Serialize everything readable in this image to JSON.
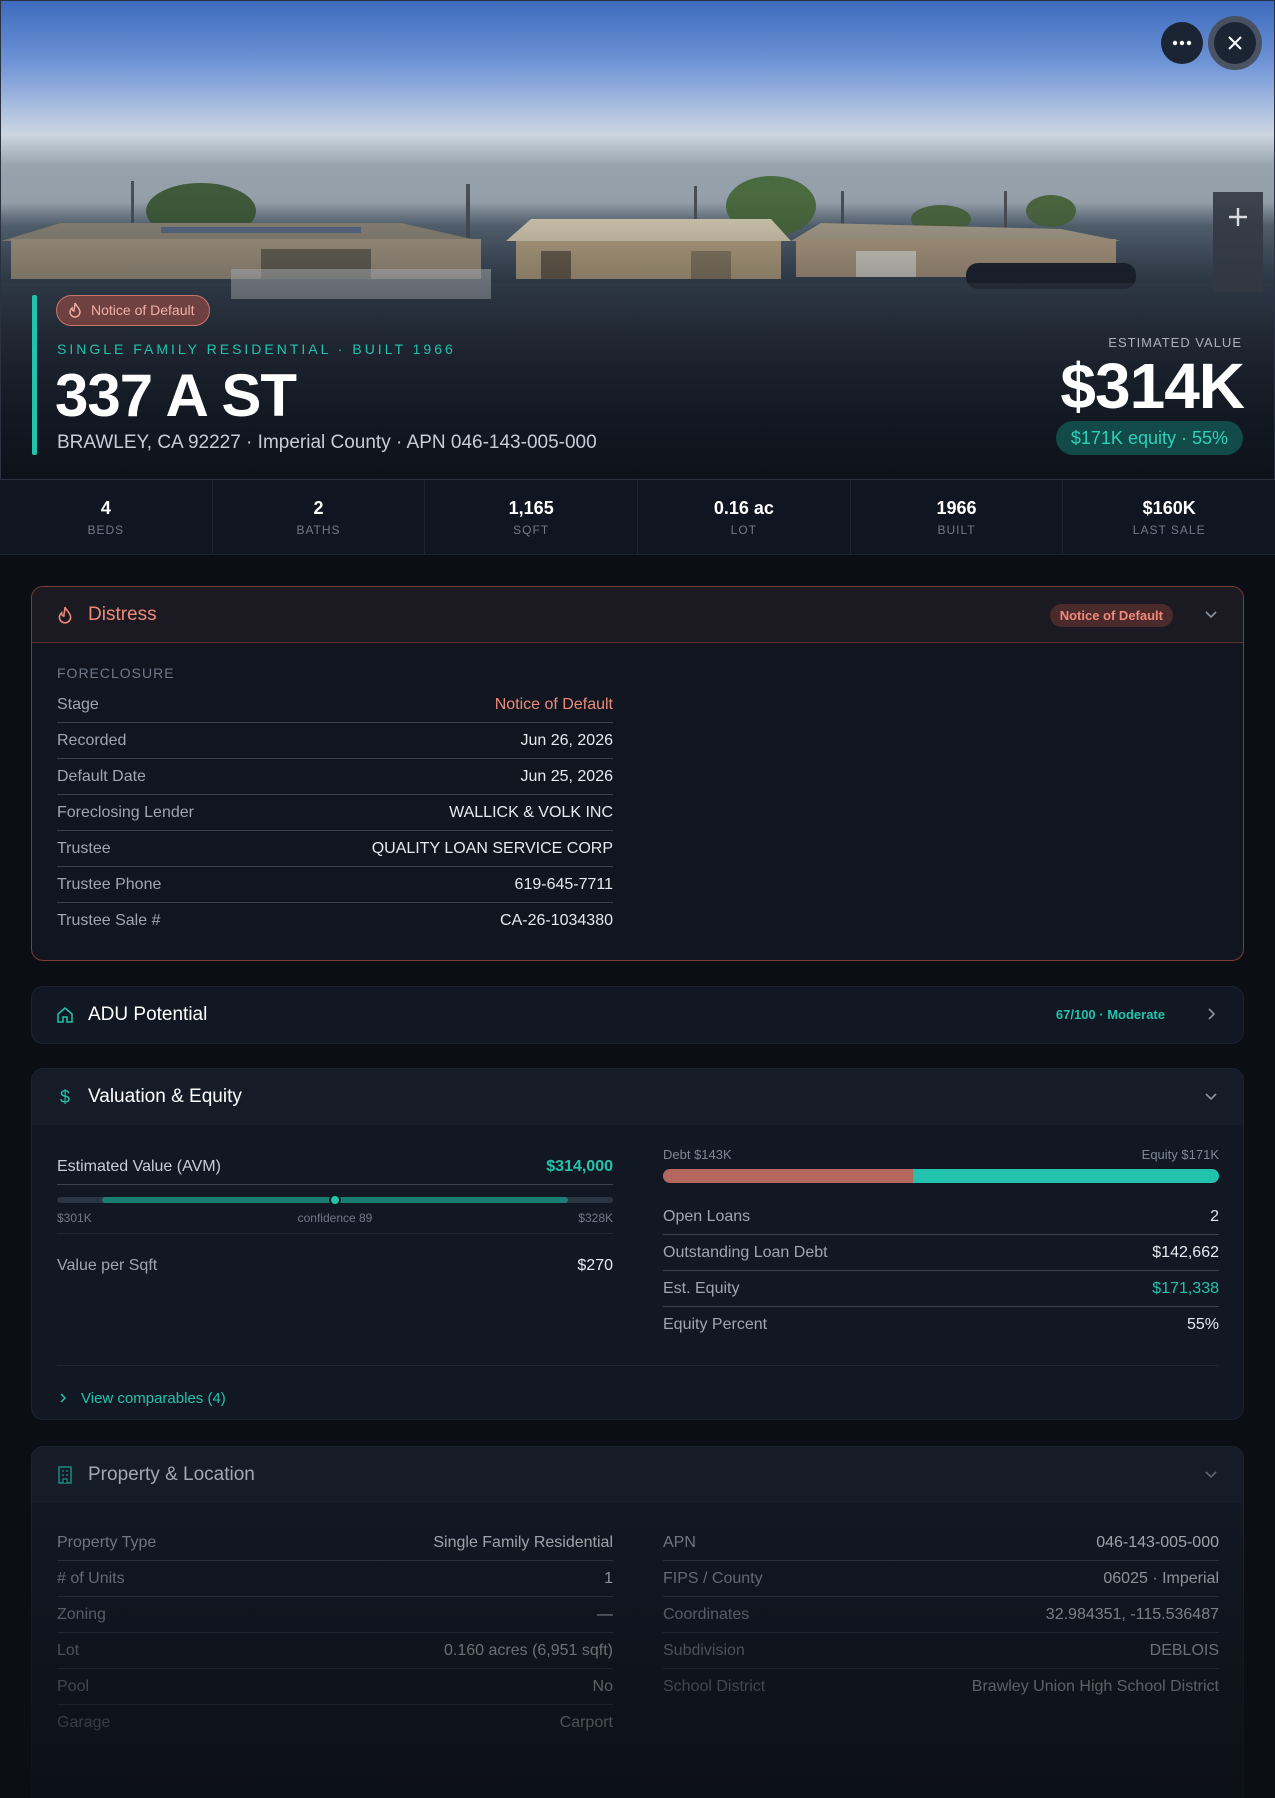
{
  "hero": {
    "status_pill": "Notice of Default",
    "eyebrow": "SINGLE FAMILY RESIDENTIAL · BUILT 1966",
    "title": "337 A ST",
    "subtitle": "BRAWLEY, CA 92227 · Imperial County · APN 046-143-005-000",
    "estimated_label": "ESTIMATED VALUE",
    "estimated_value": "$314K",
    "equity_pill": "$171K equity · 55%",
    "buttons": {
      "more_icon": "more-horizontal-icon",
      "close_icon": "close-icon",
      "zoom_in_icon": "plus-icon"
    }
  },
  "stats": [
    {
      "value": "4",
      "label": "BEDS"
    },
    {
      "value": "2",
      "label": "BATHS"
    },
    {
      "value": "1,165",
      "label": "SQFT"
    },
    {
      "value": "0.16 ac",
      "label": "LOT"
    },
    {
      "value": "1966",
      "label": "BUILT"
    },
    {
      "value": "$160K",
      "label": "LAST SALE"
    }
  ],
  "distress": {
    "title": "Distress",
    "badge": "Notice of Default",
    "section_label": "FORECLOSURE",
    "rows": [
      {
        "k": "Stage",
        "v": "Notice of Default"
      },
      {
        "k": "Recorded",
        "v": "Jun 26, 2026"
      },
      {
        "k": "Default Date",
        "v": "Jun 25, 2026"
      },
      {
        "k": "Foreclosing Lender",
        "v": "WALLICK & VOLK INC"
      },
      {
        "k": "Trustee",
        "v": "QUALITY LOAN SERVICE CORP"
      },
      {
        "k": "Trustee Phone",
        "v": "619-645-7711"
      },
      {
        "k": "Trustee Sale #",
        "v": "CA-26-1034380"
      }
    ]
  },
  "adu": {
    "title": "ADU Potential",
    "score": "67/100 · Moderate"
  },
  "valuation": {
    "title": "Valuation & Equity",
    "avm_label": "Estimated Value (AVM)",
    "avm_value": "$314,000",
    "range_low": "$301K",
    "range_high": "$328K",
    "confidence": "confidence 89",
    "avm_position": 0.5,
    "value_per_sqft_label": "Value per Sqft",
    "value_per_sqft": "$270",
    "debt_label": "Debt $143K",
    "equity_label": "Equity $171K",
    "debt_fraction": 0.45,
    "rows": [
      {
        "k": "Open Loans",
        "v": "2"
      },
      {
        "k": "Outstanding Loan Debt",
        "v": "$142,662"
      },
      {
        "k": "Est. Equity",
        "v": "$171,338"
      },
      {
        "k": "Equity Percent",
        "v": "55%"
      }
    ],
    "view_comparables": "View comparables (4)"
  },
  "property": {
    "title": "Property & Location",
    "left_rows": [
      {
        "k": "Property Type",
        "v": "Single Family Residential"
      },
      {
        "k": "# of Units",
        "v": "1"
      },
      {
        "k": "Zoning",
        "v": "—"
      },
      {
        "k": "Lot",
        "v": "0.160 acres (6,951 sqft)"
      },
      {
        "k": "Pool",
        "v": "No"
      },
      {
        "k": "Garage",
        "v": "Carport"
      }
    ],
    "right_rows": [
      {
        "k": "APN",
        "v": "046-143-005-000"
      },
      {
        "k": "FIPS / County",
        "v": "06025 · Imperial"
      },
      {
        "k": "Coordinates",
        "v": "32.984351, -115.536487"
      },
      {
        "k": "Subdivision",
        "v": "DEBLOIS"
      },
      {
        "k": "School District",
        "v": "Brawley Union High School District"
      }
    ]
  },
  "colors": {
    "accent": "#22c2ad",
    "danger": "#ef8a79",
    "debt": "#b5675d"
  }
}
